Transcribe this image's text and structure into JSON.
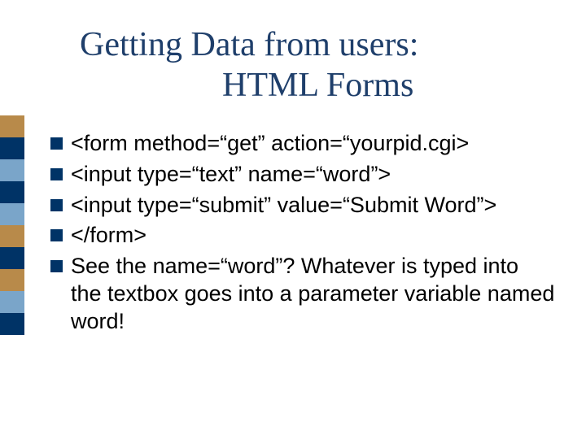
{
  "title": {
    "line1": "Getting Data from users:",
    "line2": "HTML Forms"
  },
  "bullets": [
    {
      "text": "<form method=“get” action=“yourpid.cgi>"
    },
    {
      "text": "<input type=“text” name=“word”>"
    },
    {
      "text": "<input type=“submit” value=“Submit Word”>"
    },
    {
      "text": "</form>"
    },
    {
      "text": "See the name=“word”?  Whatever is typed into the textbox goes into a parameter variable named word!"
    }
  ]
}
